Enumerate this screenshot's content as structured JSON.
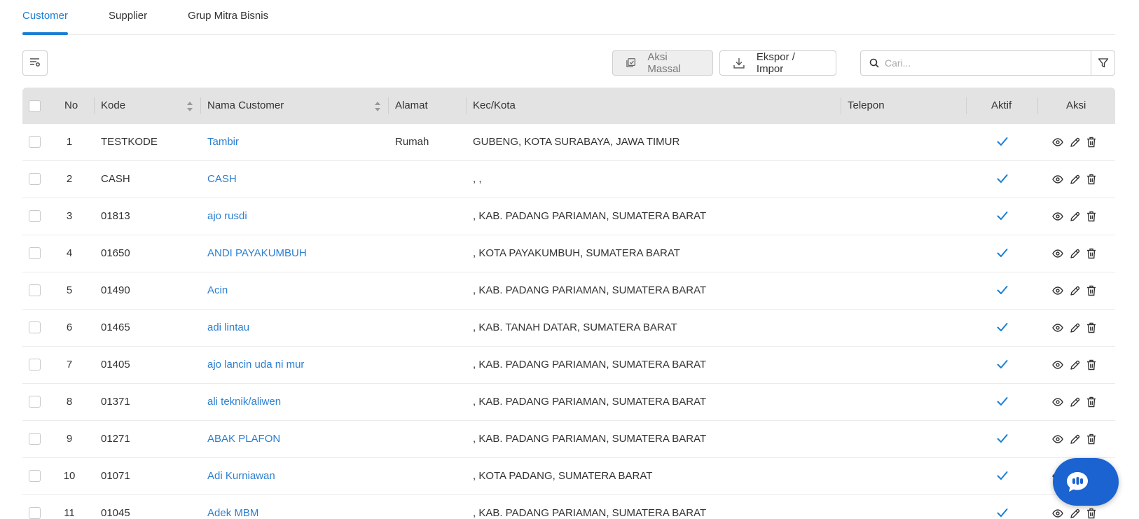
{
  "tabs": [
    {
      "label": "Customer",
      "active": true
    },
    {
      "label": "Supplier",
      "active": false
    },
    {
      "label": "Grup Mitra Bisnis",
      "active": false
    }
  ],
  "toolbar": {
    "mass_action_label": "Aksi Massal",
    "export_label": "Ekspor / Impor",
    "search_placeholder": "Cari..."
  },
  "columns": {
    "no": "No",
    "kode": "Kode",
    "nama": "Nama Customer",
    "alamat": "Alamat",
    "kota": "Kec/Kota",
    "telepon": "Telepon",
    "aktif": "Aktif",
    "aksi": "Aksi"
  },
  "rows": [
    {
      "no": "1",
      "kode": "TESTKODE",
      "nama": "Tambir",
      "alamat": "Rumah",
      "kota": "GUBENG, KOTA SURABAYA, JAWA TIMUR",
      "telepon": "",
      "aktif": true
    },
    {
      "no": "2",
      "kode": "CASH",
      "nama": "CASH",
      "alamat": "",
      "kota": ", ,",
      "telepon": "",
      "aktif": true
    },
    {
      "no": "3",
      "kode": "01813",
      "nama": "ajo rusdi",
      "alamat": "",
      "kota": ", KAB. PADANG PARIAMAN, SUMATERA BARAT",
      "telepon": "",
      "aktif": true
    },
    {
      "no": "4",
      "kode": "01650",
      "nama": "ANDI PAYAKUMBUH",
      "alamat": "",
      "kota": ", KOTA PAYAKUMBUH, SUMATERA BARAT",
      "telepon": "",
      "aktif": true
    },
    {
      "no": "5",
      "kode": "01490",
      "nama": "Acin",
      "alamat": "",
      "kota": ", KAB. PADANG PARIAMAN, SUMATERA BARAT",
      "telepon": "",
      "aktif": true
    },
    {
      "no": "6",
      "kode": "01465",
      "nama": "adi lintau",
      "alamat": "",
      "kota": ", KAB. TANAH DATAR, SUMATERA BARAT",
      "telepon": "",
      "aktif": true
    },
    {
      "no": "7",
      "kode": "01405",
      "nama": "ajo lancin uda ni mur",
      "alamat": "",
      "kota": ", KAB. PADANG PARIAMAN, SUMATERA BARAT",
      "telepon": "",
      "aktif": true
    },
    {
      "no": "8",
      "kode": "01371",
      "nama": "ali teknik/aliwen",
      "alamat": "",
      "kota": ", KAB. PADANG PARIAMAN, SUMATERA BARAT",
      "telepon": "",
      "aktif": true
    },
    {
      "no": "9",
      "kode": "01271",
      "nama": "ABAK PLAFON",
      "alamat": "",
      "kota": ", KAB. PADANG PARIAMAN, SUMATERA BARAT",
      "telepon": "",
      "aktif": true
    },
    {
      "no": "10",
      "kode": "01071",
      "nama": "Adi Kurniawan",
      "alamat": "",
      "kota": ", KOTA PADANG, SUMATERA BARAT",
      "telepon": "",
      "aktif": true
    },
    {
      "no": "11",
      "kode": "01045",
      "nama": "Adek MBM",
      "alamat": "",
      "kota": ", KAB. PADANG PARIAMAN, SUMATERA BARAT",
      "telepon": "",
      "aktif": true
    }
  ],
  "colors": {
    "accent": "#1a7fd4",
    "link": "#2b7fd0",
    "header_bg": "#e3e3e3",
    "chat_button": "#1a63d1"
  },
  "icons": [
    "column-settings-icon",
    "mass-action-icon",
    "download-icon",
    "search-icon",
    "filter-icon",
    "sort-icon",
    "check-icon",
    "eye-icon",
    "pencil-icon",
    "trash-icon",
    "chat-icon"
  ]
}
